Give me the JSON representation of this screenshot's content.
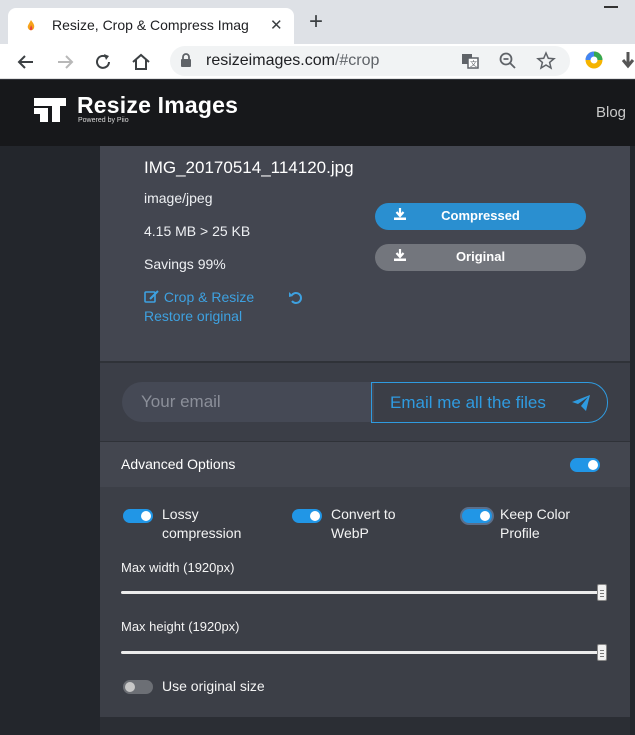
{
  "browser": {
    "tab_title": "Resize, Crop & Compress Imag",
    "tab_close": "✕",
    "new_tab": "+",
    "url_host": "resizeimages.com",
    "url_path": "/#crop"
  },
  "site": {
    "logo_text": "Resize Images",
    "logo_sub": "Powered by Piio",
    "nav_blog": "Blog"
  },
  "file": {
    "name": "IMG_20170514_114120.jpg",
    "type": "image/jpeg",
    "sizes": "4.15 MB > 25 KB",
    "savings": "Savings 99%",
    "crop_link": "Crop & Resize",
    "restore_link": "Restore original",
    "compressed_btn": "Compressed",
    "original_btn": "Original"
  },
  "email": {
    "placeholder": "Your email",
    "button": "Email me all the files"
  },
  "advanced": {
    "title": "Advanced Options",
    "enabled": true,
    "options": [
      {
        "label_1": "Lossy",
        "label_2": "compression",
        "on": true
      },
      {
        "label_1": "Convert to",
        "label_2": "WebP",
        "on": true
      },
      {
        "label_1": "Keep Color",
        "label_2": "Profile",
        "on": true
      }
    ],
    "max_width_label": "Max width (1920px)",
    "max_height_label": "Max height (1920px)",
    "max_width_value": 1920,
    "max_height_value": 1920,
    "use_original_label": "Use original size",
    "use_original_on": false
  },
  "colors": {
    "accent": "#2196e6",
    "compressed_btn": "#2a8fd0",
    "original_btn": "#73767d",
    "header_bg": "#17181b"
  }
}
